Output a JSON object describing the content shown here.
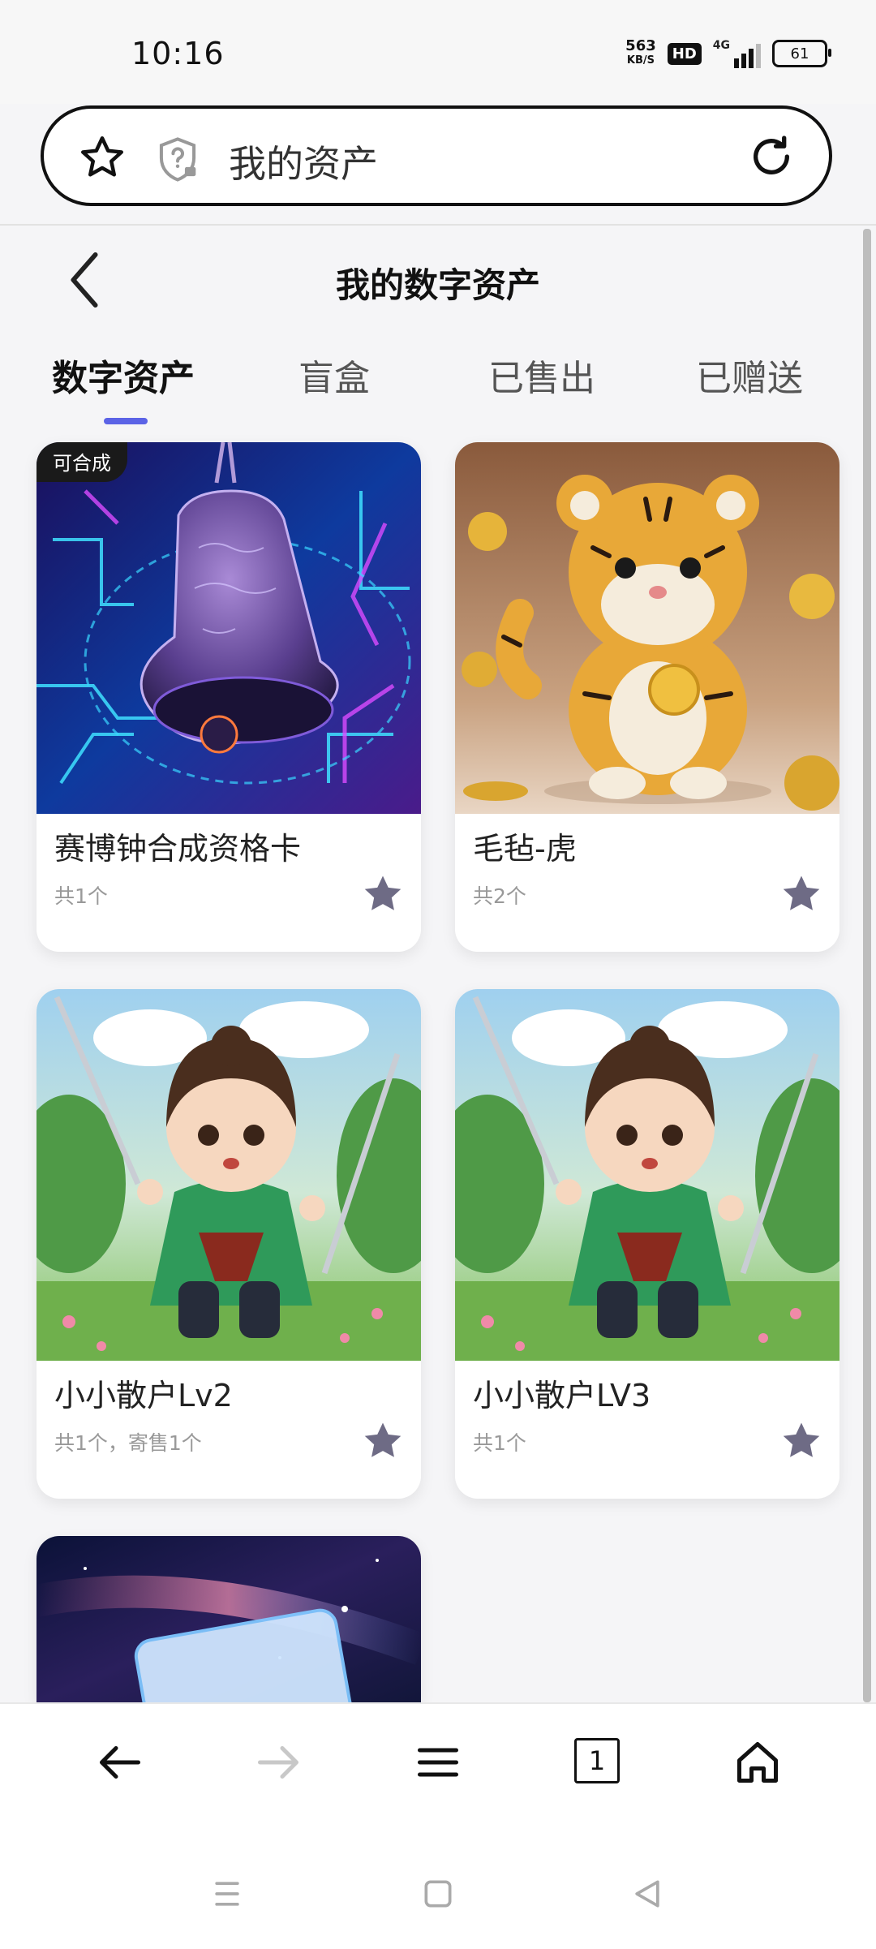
{
  "status_bar": {
    "time": "10:16",
    "net_speed_value": "563",
    "net_speed_unit": "KB/S",
    "hd": "HD",
    "network": "4G",
    "battery": "61"
  },
  "address_bar": {
    "text": "我的资产",
    "star_icon": "star-outline-icon",
    "shield_icon": "shield-question-icon",
    "reload_icon": "reload-icon"
  },
  "header": {
    "back_icon": "chevron-left-icon",
    "title": "我的数字资产"
  },
  "tabs": [
    {
      "label": "数字资产",
      "active": true
    },
    {
      "label": "盲盒",
      "active": false
    },
    {
      "label": "已售出",
      "active": false
    },
    {
      "label": "已赠送",
      "active": false
    }
  ],
  "accent_color": "#5b63e6",
  "cards": [
    {
      "name": "赛博钟合成资格卡",
      "count": "共1个",
      "badge": "可合成",
      "image": "cyber-bell"
    },
    {
      "name": "毛毡-虎",
      "count": "共2个",
      "image": "felt-tiger"
    },
    {
      "name": "小小散户Lv2",
      "count": "共1个，寄售1个",
      "image": "swordsman"
    },
    {
      "name": "小小散户LV3",
      "count": "共1个",
      "image": "swordsman"
    },
    {
      "name": "",
      "count": "",
      "image": "galaxy-card"
    }
  ],
  "browser_nav": [
    "back-arrow-icon",
    "forward-arrow-icon",
    "menu-icon",
    "tabs-icon",
    "home-icon"
  ],
  "tab_count": "1",
  "system_nav": [
    "recents-icon",
    "home-square-icon",
    "back-triangle-icon"
  ]
}
